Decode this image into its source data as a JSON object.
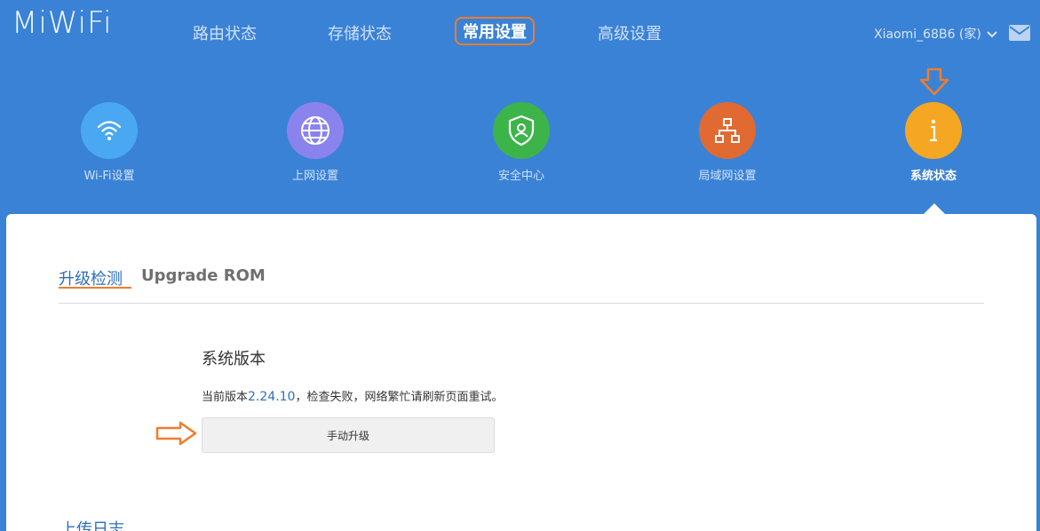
{
  "logo": "MiWiFi",
  "topnav": [
    {
      "label": "路由状态"
    },
    {
      "label": "存储状态"
    },
    {
      "label": "常用设置"
    },
    {
      "label": "高级设置"
    }
  ],
  "account": {
    "name": "Xiaomi_68B6 (家)"
  },
  "icons": [
    {
      "label": "Wi-Fi设置",
      "color": "#4aa8f2",
      "icon": "wifi-icon"
    },
    {
      "label": "上网设置",
      "color": "#8a83ee",
      "icon": "globe-icon"
    },
    {
      "label": "安全中心",
      "color": "#3cb449",
      "icon": "shield-user-icon"
    },
    {
      "label": "局域网设置",
      "color": "#e06a32",
      "icon": "network-icon"
    },
    {
      "label": "系统状态",
      "color": "#f5a623",
      "icon": "info-icon"
    }
  ],
  "tabs": {
    "active": "升级检测",
    "other": "Upgrade ROM"
  },
  "system": {
    "title": "系统版本",
    "prefix": "当前版本",
    "version": "2.24.10",
    "suffix": "，检查失败，网络繁忙请刷新页面重试。",
    "button": "手动升级"
  },
  "log": {
    "title": "上传日志"
  },
  "colors": {
    "background": "#3a82d6",
    "accent": "#ef7d2c",
    "link": "#2f6fba"
  }
}
